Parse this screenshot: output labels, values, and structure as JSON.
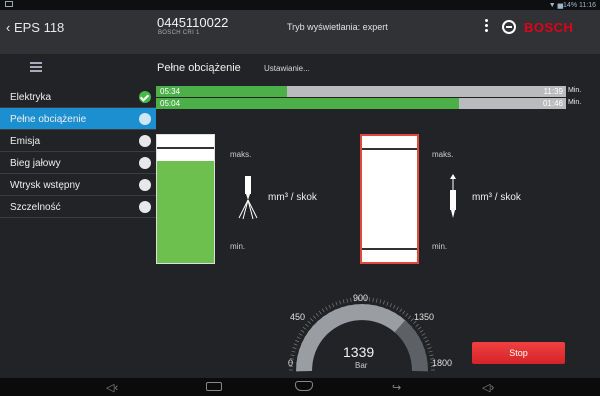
{
  "status": {
    "right_text": "▼ ▅14% 11:16"
  },
  "header": {
    "back_label": "‹ EPS 118",
    "device_id": "0445110022",
    "device_sub": "BOSCH CRI 1",
    "mode_text": "Tryb wyświetlania: expert",
    "brand": "BOSCH",
    "menu_icon": "kebab-menu-icon",
    "logo_icon": "bosch-armature-icon"
  },
  "subheader": {
    "title": "Pełne obciążenie",
    "settings": "Ustawianie..."
  },
  "sidebar": {
    "items": [
      {
        "label": "Elektryka",
        "state": "done"
      },
      {
        "label": "Pełne obciążenie",
        "state": "active"
      },
      {
        "label": "Emisja",
        "state": "pending"
      },
      {
        "label": "Bieg jałowy",
        "state": "pending"
      },
      {
        "label": "Wtrysk wstępny",
        "state": "pending"
      },
      {
        "label": "Szczelność",
        "state": "pending"
      }
    ]
  },
  "progress": [
    {
      "elapsed": "05:34",
      "remaining": "11:39",
      "unit": "Min.",
      "fraction": 0.32
    },
    {
      "elapsed": "05:04",
      "remaining": "01:46",
      "unit": "Min.",
      "fraction": 0.74
    }
  ],
  "left_gauge": {
    "max_label": "maks.",
    "min_label": "min.",
    "unit_label": "mm³ / skok",
    "fill_color": "#6ec04e",
    "icon": "injector-spray-icon"
  },
  "right_gauge": {
    "max_label": "maks.",
    "min_label": "min.",
    "unit_label": "mm³ / skok",
    "border_color": "#e04a3c",
    "icon": "injector-return-icon"
  },
  "pressure": {
    "value": "1339",
    "unit": "Bar",
    "ticks": [
      "0",
      "450",
      "900",
      "1350",
      "1800"
    ],
    "max": 1800
  },
  "stop_button": {
    "label": "Stop",
    "color": "#e53535"
  },
  "navbar": {
    "icons": [
      "volume-down-icon",
      "recent-apps-icon",
      "home-icon",
      "back-icon",
      "volume-up-icon"
    ]
  }
}
